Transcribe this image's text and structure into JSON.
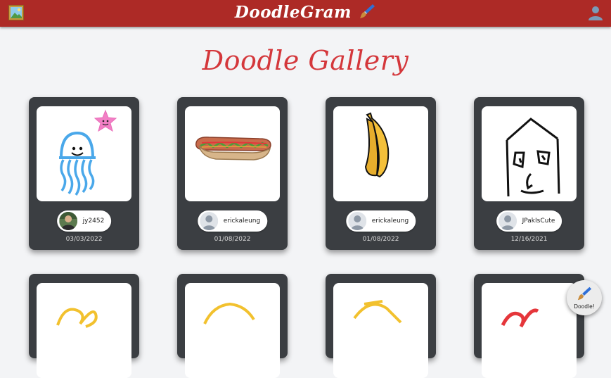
{
  "header": {
    "brand": "DoodleGram",
    "gallery_icon": "picture-icon",
    "brush_icon": "paintbrush-icon",
    "profile_icon": "user-silhouette-icon",
    "bar_color": "#ad2a26"
  },
  "page": {
    "title": "Doodle Gallery",
    "title_color": "#d4373b"
  },
  "gallery": {
    "cards": [
      {
        "doodle": "jellyfish-and-starfish",
        "username": "jy2452",
        "avatar": "photo",
        "date": "03/03/2022"
      },
      {
        "doodle": "hotdog",
        "username": "erickaleung",
        "avatar": "default",
        "date": "01/08/2022"
      },
      {
        "doodle": "banana",
        "username": "erickaleung",
        "avatar": "default",
        "date": "01/08/2022"
      },
      {
        "doodle": "house-face",
        "username": "JPakIsCute",
        "avatar": "default",
        "date": "12/16/2021"
      }
    ]
  },
  "fab": {
    "label": "Doodle!",
    "icon": "paintbrush-icon"
  }
}
